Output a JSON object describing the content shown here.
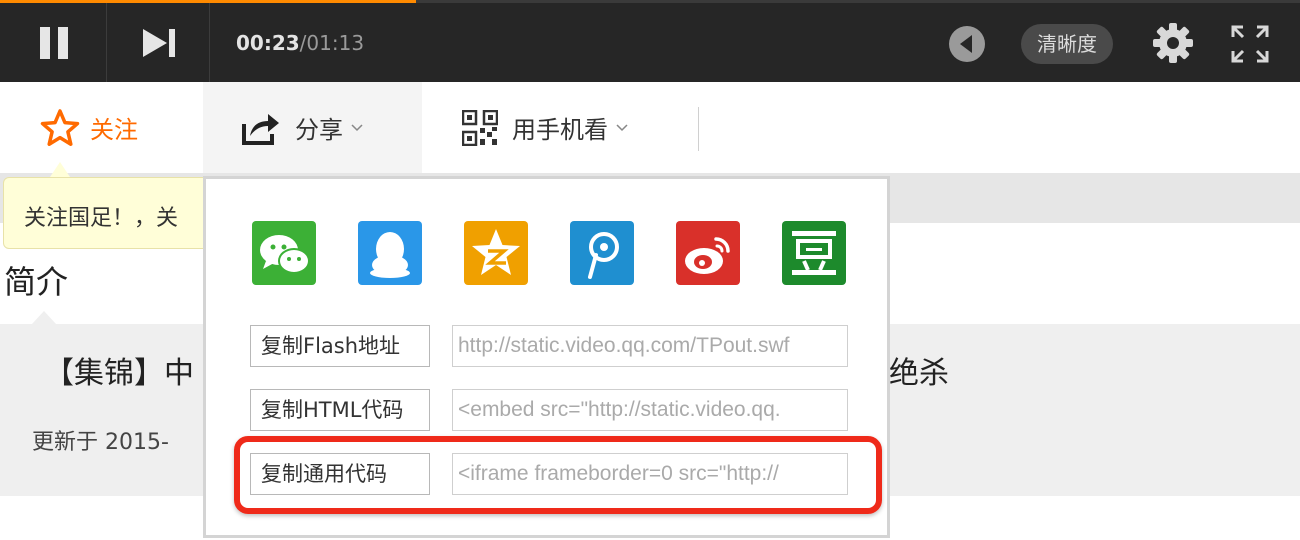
{
  "player": {
    "current_time": "00:23",
    "separator": "/",
    "duration": "01:13",
    "progress_fraction": 0.32,
    "quality_label": "清晰度",
    "accent_color": "#ff8a00"
  },
  "actions": {
    "follow_label": "关注",
    "share_label": "分享",
    "mobile_label": "用手机看"
  },
  "tooltip": {
    "text": "关注国足！，关"
  },
  "intro": {
    "heading": "简介",
    "video_title_left": "【集锦】中",
    "video_title_right": "可绝杀",
    "update_prefix": "更新于 2015-"
  },
  "share_panel": {
    "icons": [
      {
        "name": "wechat-icon",
        "color": "#3cb036"
      },
      {
        "name": "qq-icon",
        "color": "#2a97e8"
      },
      {
        "name": "qzone-icon",
        "color": "#f0a000"
      },
      {
        "name": "tencent-weibo-icon",
        "color": "#1f8fd0"
      },
      {
        "name": "sina-weibo-icon",
        "color": "#d9302a"
      },
      {
        "name": "douban-icon",
        "color": "#1d8a2c"
      }
    ],
    "rows": [
      {
        "button": "复制Flash地址",
        "value": "http://static.video.qq.com/TPout.swf"
      },
      {
        "button": "复制HTML代码",
        "value": "<embed src=\"http://static.video.qq."
      },
      {
        "button": "复制通用代码",
        "value": "<iframe frameborder=0 src=\"http://"
      }
    ],
    "highlight_color": "#ef2a1a"
  }
}
